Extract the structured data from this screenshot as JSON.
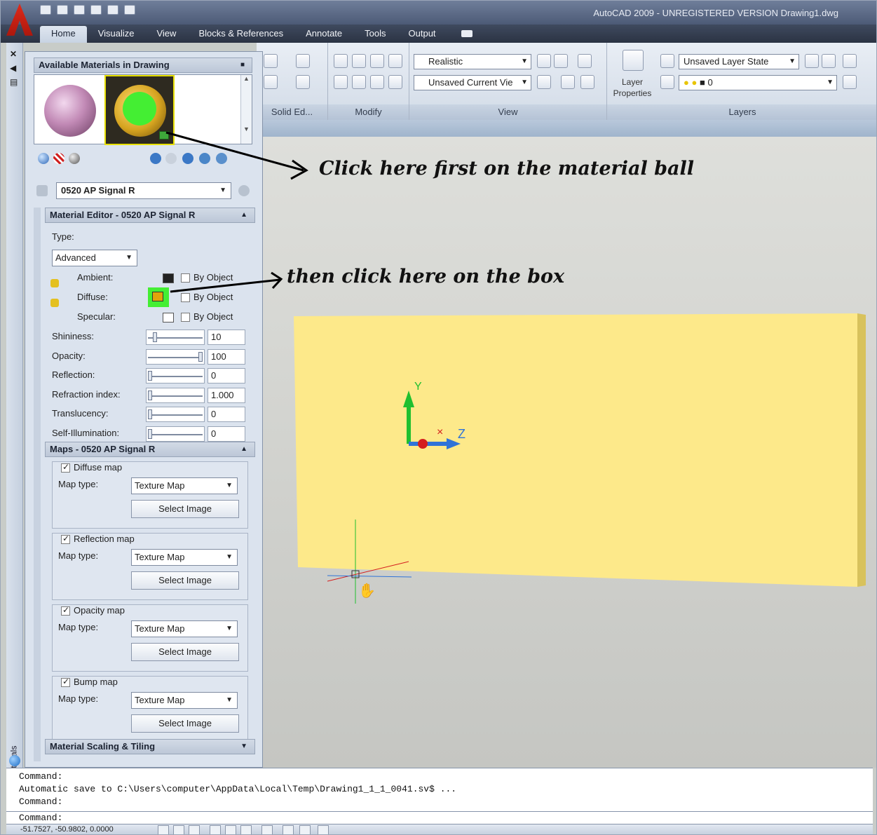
{
  "window_title": "AutoCAD 2009 - UNREGISTERED VERSION Drawing1.dwg",
  "ribbon": {
    "tabs": [
      {
        "label": "Home",
        "active": true
      },
      {
        "label": "Visualize"
      },
      {
        "label": "View"
      },
      {
        "label": "Blocks & References"
      },
      {
        "label": "Annotate"
      },
      {
        "label": "Tools"
      },
      {
        "label": "Output"
      }
    ],
    "panels": {
      "solid_editing": "Solid Ed...",
      "modify": "Modify",
      "view": "View",
      "layers": "Layers"
    },
    "visual_style": "Realistic",
    "view_select": "Unsaved Current Vie",
    "layer_properties": "Layer Properties",
    "layer_state": "Unsaved Layer State",
    "current_layer": "0"
  },
  "palette": {
    "strip_label": "Materials",
    "available_header": "Available Materials in Drawing",
    "current_material": "0520 AP Signal R",
    "editor_header": "Material Editor - 0520 AP Signal R",
    "type_label": "Type:",
    "type_value": "Advanced",
    "ambient_label": "Ambient:",
    "diffuse_label": "Diffuse:",
    "specular_label": "Specular:",
    "by_object": "By Object",
    "properties": [
      {
        "label": "Shininess:",
        "value": "10",
        "fraction": 0.1
      },
      {
        "label": "Opacity:",
        "value": "100",
        "fraction": 1.0
      },
      {
        "label": "Reflection:",
        "value": "0",
        "fraction": 0
      },
      {
        "label": "Refraction index:",
        "value": "1.000",
        "fraction": 0
      },
      {
        "label": "Translucency:",
        "value": "0",
        "fraction": 0
      },
      {
        "label": "Self-Illumination:",
        "value": "0",
        "fraction": 0
      }
    ],
    "maps_header": "Maps - 0520 AP Signal R",
    "map_type_label": "Map type:",
    "select_image": "Select Image",
    "maps": [
      {
        "name": "Diffuse map",
        "checked": true,
        "type": "Texture Map"
      },
      {
        "name": "Reflection map",
        "checked": true,
        "type": "Texture Map"
      },
      {
        "name": "Opacity map",
        "checked": true,
        "type": "Texture Map"
      },
      {
        "name": "Bump map",
        "checked": true,
        "type": "Texture Map"
      }
    ],
    "scaling_header": "Material Scaling & Tiling"
  },
  "annotations": {
    "first": "Click here first on the material ball",
    "second": "then click here on the box"
  },
  "ucs": {
    "y": "Y",
    "z": "Z"
  },
  "command_lines": [
    "Command:",
    "Automatic save to C:\\Users\\computer\\AppData\\Local\\Temp\\Drawing1_1_1_0041.sv$ ...",
    "Command:",
    "Command:"
  ],
  "status": {
    "coordinates": "-51.7527,  -50.9802,  0.0000"
  },
  "colors": {
    "box_face": "#fde98a",
    "box_side": "#d8c25c",
    "diffuse_color": "#e0a40a",
    "highlight": "#44ee33"
  }
}
